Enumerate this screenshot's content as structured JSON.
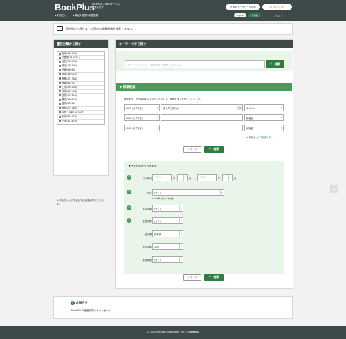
{
  "header": {
    "logo": "BookPlus",
    "tagline_line1": "NICHIGAI / WEBサービス",
    "tagline_line2": "図書を探す",
    "contract_button": "契約データベース切替",
    "logout_button": "ログアウト",
    "nav_notice": "お知らせ",
    "nav_recent": "最近1週間の新着図書",
    "lang_english": "English",
    "lang_japanese": "日本語",
    "nav_help": "ヘルプ"
  },
  "intro": {
    "text": "明治期から現在までの国内の図書情報を検索できます。"
  },
  "sidebar": {
    "title": "書店分類から探す",
    "items": [
      {
        "label": "実用(434706)"
      },
      {
        "label": "児童書(116872)"
      },
      {
        "label": "社会(286456)"
      },
      {
        "label": "政治(165542)"
      },
      {
        "label": "法律(95064)"
      },
      {
        "label": "経済(330721)"
      },
      {
        "label": "産業(271364)"
      },
      {
        "label": "情報(81592)"
      },
      {
        "label": "工学(294254)"
      },
      {
        "label": "科学(315448)"
      },
      {
        "label": "哲学(179818)"
      },
      {
        "label": "歴史(296826)"
      },
      {
        "label": "語学(87898)"
      },
      {
        "label": "教育(207265)"
      },
      {
        "label": "芸術・芸能(325719)"
      },
      {
        "label": "文学(350074)"
      },
      {
        "label": "小説(373813)"
      }
    ],
    "note": "＋印をクリックすると下位分類が表示されます。"
  },
  "keyword": {
    "title": "キーワードから探す",
    "placeholder": "キーワードを入力し、検索ボタンを押してください。",
    "search_label": "検索"
  },
  "advanced": {
    "title": "▼ 詳細検索",
    "instruction": "検索条件：下記項目の1つ以上に入力して、検索ボタンを押してください。",
    "rows": [
      {
        "op": "AND（必ずある）",
        "value": "風と共に去りぬ",
        "field": "タイトル"
      },
      {
        "op": "AND（必ずある）",
        "value": "",
        "field": "著者名"
      },
      {
        "op": "AND（必ずある）",
        "value": "",
        "field": "出版者"
      }
    ],
    "add_box": "検索ボックスを増やす",
    "clear_label": "クリア",
    "search_label": "検索"
  },
  "filter": {
    "title": "▼ その他の絞り込み条件：",
    "pub_label": "刊行年月",
    "pub_from_year": "2001",
    "year_unit": "年",
    "month_unit": "月",
    "tilde": "〜",
    "pub_to_year": "2002",
    "form_label": "形式",
    "form_value": "(全て)",
    "form_note": "*1988年以降のみの対象",
    "shop_label": "書店分類",
    "shop_value": "(全て)",
    "subject_label": "主題分野",
    "subject_value": "(全て)",
    "order_label": "並び順",
    "order_value": "新着順",
    "count_label": "表示件数",
    "count_value": "20件",
    "period_label": "登録期間",
    "period_value": "(全て)",
    "clear_label": "クリア",
    "search_label": "検索"
  },
  "notice": {
    "title": "お知らせ",
    "message": "BOOKPLUS画面お知らせメッセージ"
  },
  "footer": {
    "text": "© 2020 Nichigai Associates, Inc. / 禁無断転載"
  }
}
